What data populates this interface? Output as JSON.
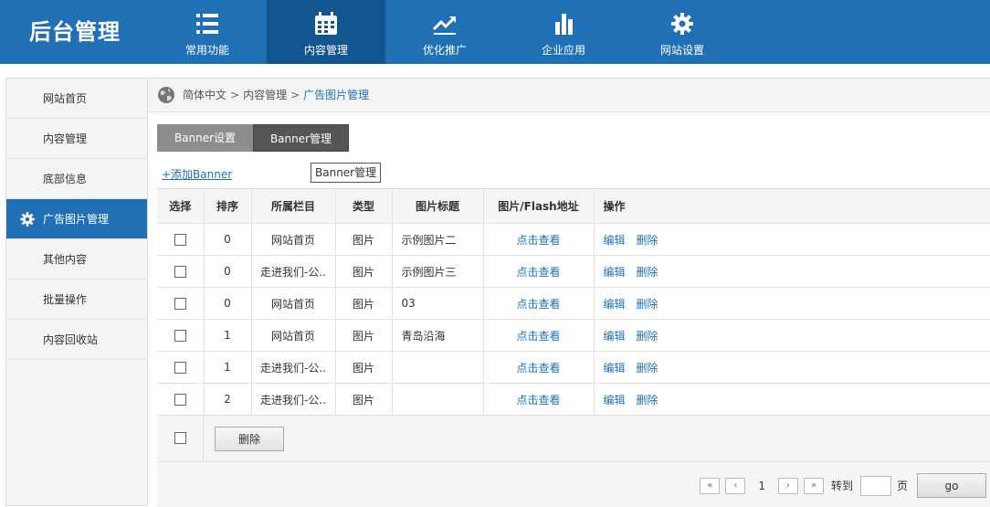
{
  "app": {
    "logo": "后台管理"
  },
  "colors": {
    "brand": "#2170b5",
    "nav_active": "#13558f",
    "link": "#2170b5"
  },
  "nav": [
    {
      "label": "常用功能",
      "icon": "list-icon"
    },
    {
      "label": "内容管理",
      "icon": "calendar-icon",
      "active": true
    },
    {
      "label": "优化推广",
      "icon": "trend-icon"
    },
    {
      "label": "企业应用",
      "icon": "bar-chart-icon"
    },
    {
      "label": "网站设置",
      "icon": "gear-icon"
    }
  ],
  "sidebar": {
    "items": [
      {
        "label": "网站首页"
      },
      {
        "label": "内容管理"
      },
      {
        "label": "底部信息"
      },
      {
        "label": "广告图片管理",
        "active": true,
        "icon": "gear-icon"
      },
      {
        "label": "其他内容"
      },
      {
        "label": "批量操作"
      },
      {
        "label": "内容回收站"
      }
    ]
  },
  "breadcrumb": {
    "items": [
      "简体中文",
      "内容管理",
      "广告图片管理"
    ],
    "separator": ">"
  },
  "tabs": [
    {
      "label": "Banner设置"
    },
    {
      "label": "Banner管理",
      "active": true
    }
  ],
  "add_link": "+添加Banner",
  "tooltip": "Banner管理",
  "table": {
    "headers": [
      "选择",
      "排序",
      "所属栏目",
      "类型",
      "图片标题",
      "图片/Flash地址",
      "操作"
    ],
    "view_label": "点击查看",
    "edit_label": "编辑",
    "delete_label": "删除",
    "rows": [
      {
        "order": "0",
        "column": "网站首页",
        "type": "图片",
        "title": "示例图片二"
      },
      {
        "order": "0",
        "column": "走进我们-公..",
        "type": "图片",
        "title": "示例图片三"
      },
      {
        "order": "0",
        "column": "网站首页",
        "type": "图片",
        "title": "03"
      },
      {
        "order": "1",
        "column": "网站首页",
        "type": "图片",
        "title": "青岛沿海"
      },
      {
        "order": "1",
        "column": "走进我们-公..",
        "type": "图片",
        "title": ""
      },
      {
        "order": "2",
        "column": "走进我们-公..",
        "type": "图片",
        "title": ""
      }
    ]
  },
  "footer": {
    "delete_button": "删除"
  },
  "pager": {
    "first": "«",
    "prev": "‹",
    "current": "1",
    "next": "›",
    "last": "»",
    "goto_label": "转到",
    "page_label": "页",
    "go_button": "go"
  }
}
